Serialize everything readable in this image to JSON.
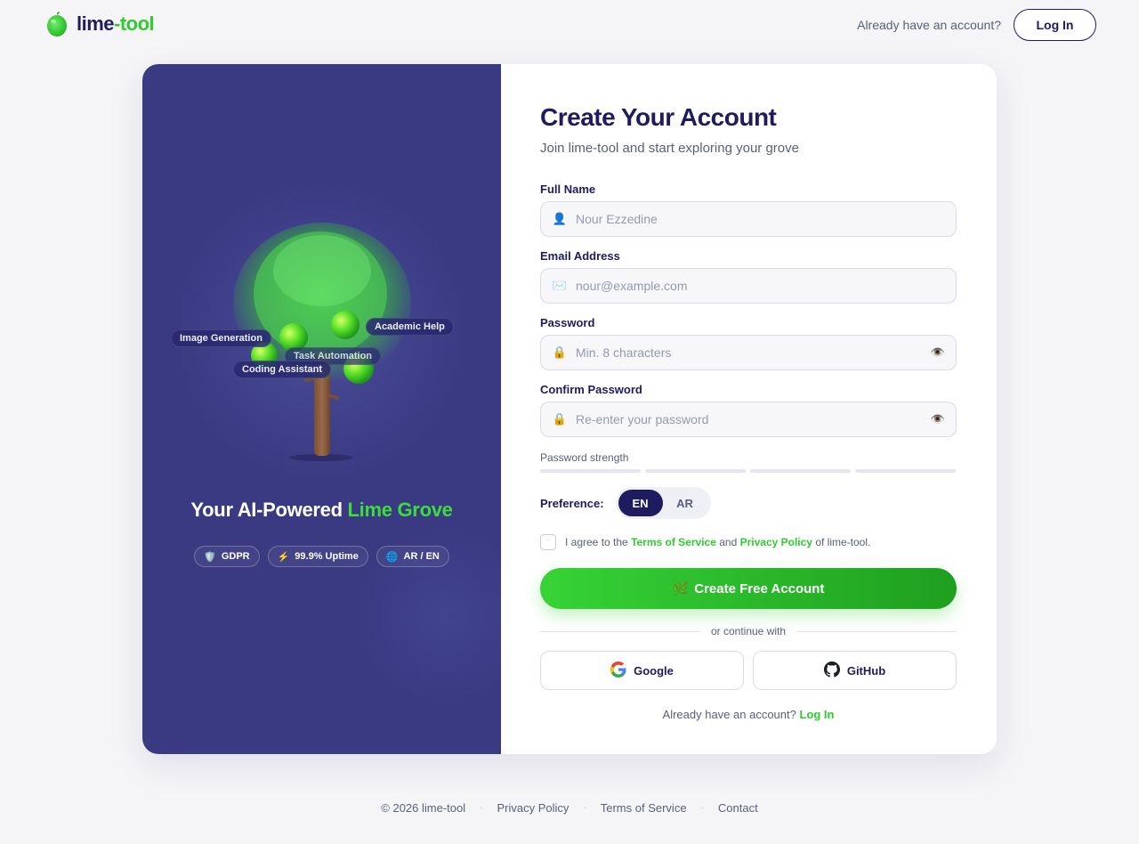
{
  "header": {
    "brand_part1": "lime",
    "brand_part2": "-tool",
    "account_prompt": "Already have an account?",
    "login_label": "Log In"
  },
  "hero": {
    "title_part1": "Your AI-Powered ",
    "title_part2": "Lime Grove",
    "fruit_labels": [
      "Image Generation",
      "Academic Help",
      "Task Automation",
      "Coding Assistant"
    ],
    "badges": [
      {
        "icon": "shield-icon",
        "glyph": "🛡️",
        "label": "GDPR"
      },
      {
        "icon": "lightning-icon",
        "glyph": "⚡",
        "label": "99.9% Uptime"
      },
      {
        "icon": "globe-icon",
        "glyph": "🌐",
        "label": "AR / EN"
      }
    ],
    "colors": {
      "panel": "#393a82",
      "accent": "#3ddc3d"
    }
  },
  "form": {
    "title": "Create Your Account",
    "subtitle": "Join lime-tool and start exploring your grove",
    "fields": {
      "full_name": {
        "label": "Full Name",
        "placeholder": "Nour Ezzedine",
        "icon": "user-icon",
        "glyph": "👤"
      },
      "email": {
        "label": "Email Address",
        "placeholder": "nour@example.com",
        "icon": "mail-icon",
        "glyph": "✉️"
      },
      "password": {
        "label": "Password",
        "placeholder": "Min. 8 characters",
        "icon": "lock-icon",
        "glyph": "🔒",
        "toggle_glyph": "👁️"
      },
      "confirm_password": {
        "label": "Confirm Password",
        "placeholder": "Re-enter your password",
        "icon": "lock-icon",
        "glyph": "🔒",
        "toggle_glyph": "👁️"
      }
    },
    "strength_label": "Password strength",
    "preference": {
      "label": "Preference:",
      "options": [
        "EN",
        "AR"
      ],
      "selected": "EN"
    },
    "terms": {
      "prefix": "I agree to the ",
      "tos": "Terms of Service",
      "middle": " and ",
      "privacy": "Privacy Policy",
      "suffix": " of lime-tool."
    },
    "cta": {
      "glyph": "🌿",
      "label": "Create Free Account"
    },
    "divider_text": "or continue with",
    "social": {
      "google": "Google",
      "github": "GitHub"
    },
    "bottom_prompt": "Already have an account? ",
    "bottom_login": "Log In"
  },
  "footer": {
    "copyright": "© 2026 lime-tool",
    "links": [
      "Privacy Policy",
      "Terms of Service",
      "Contact"
    ],
    "separator": "·"
  },
  "colors": {
    "brand_dark": "#1e1b5e",
    "brand_lime": "#2ecc2e"
  }
}
